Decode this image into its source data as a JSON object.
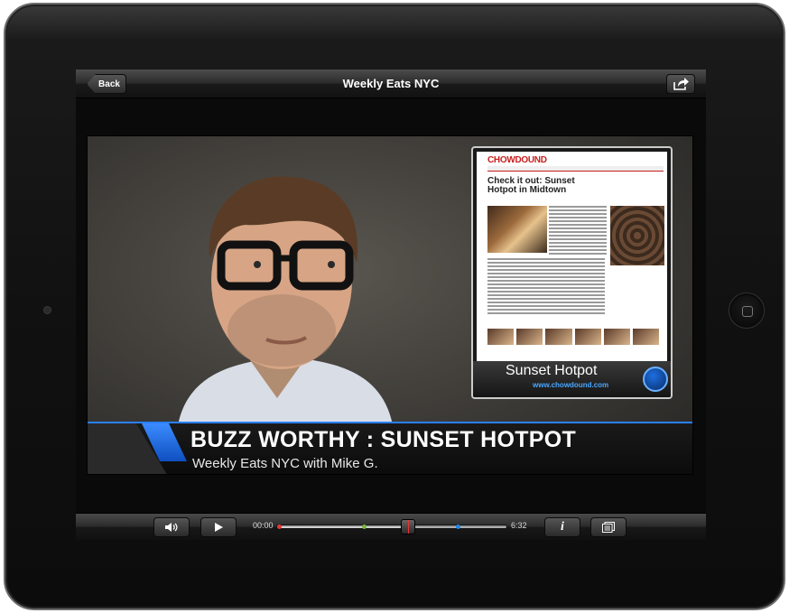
{
  "nav": {
    "back_label": "Back",
    "title": "Weekly Eats NYC",
    "share_icon": "share-icon"
  },
  "video": {
    "inset": {
      "site_logo": "CHOWDOUND",
      "article_title": "Check it out: Sunset Hotpot in Midtown",
      "label": "Sunset Hotpot",
      "url": "www.chowdound.com"
    },
    "headline": "BUZZ WORTHY : SUNSET HOTPOT",
    "subline": "Weekly Eats NYC with Mike G."
  },
  "controls": {
    "volume_icon": "speaker-icon",
    "play_icon": "play-icon",
    "time_current": "00:00",
    "time_total": "6:32",
    "progress": 0.57,
    "markers": [
      {
        "position": 0.0,
        "color": "#e53935"
      },
      {
        "position": 0.37,
        "color": "#7cb342"
      },
      {
        "position": 0.55,
        "color": "#f5e6c8"
      },
      {
        "position": 0.78,
        "color": "#1e88e5"
      }
    ],
    "info_icon": "info-icon",
    "chapters_icon": "chapters-icon"
  }
}
